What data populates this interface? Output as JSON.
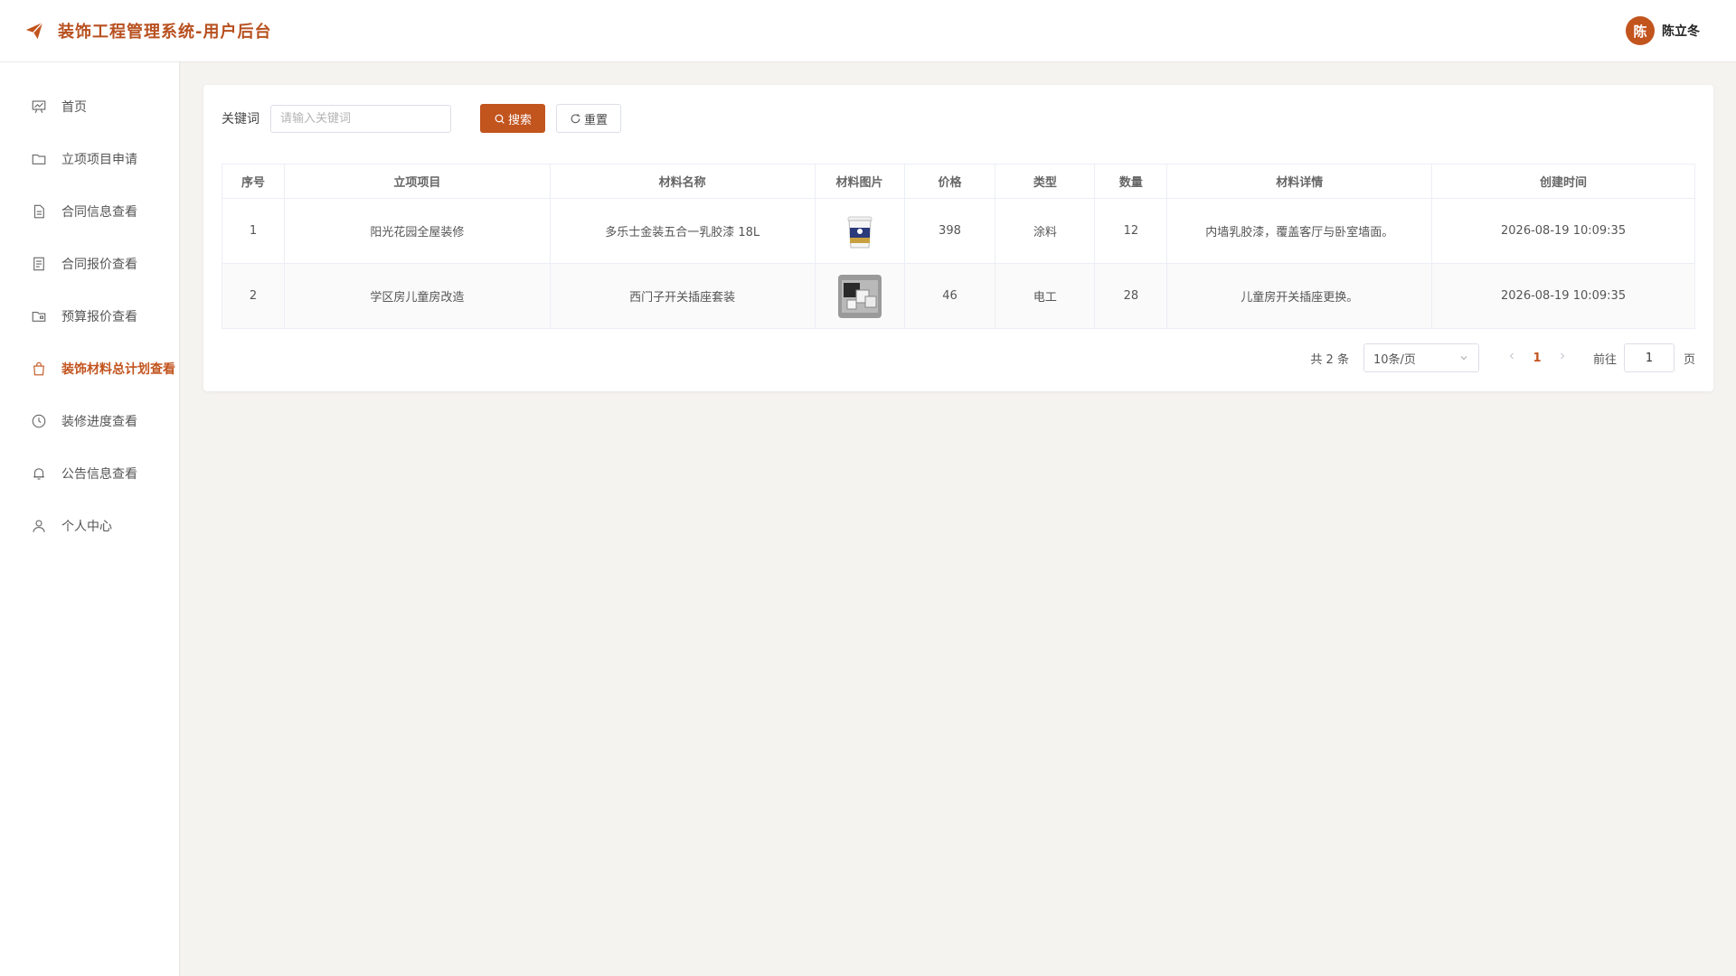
{
  "header": {
    "title": "装饰工程管理系统-用户后台",
    "logo_icon": "paper-plane-icon",
    "user": {
      "avatar_text": "陈",
      "name": "陈立冬"
    }
  },
  "sidebar": {
    "items": [
      {
        "label": "首页",
        "icon": "presentation-chart-icon",
        "active": false
      },
      {
        "label": "立项项目申请",
        "icon": "folder-icon",
        "active": false
      },
      {
        "label": "合同信息查看",
        "icon": "document-icon",
        "active": false
      },
      {
        "label": "合同报价查看",
        "icon": "document-list-icon",
        "active": false
      },
      {
        "label": "预算报价查看",
        "icon": "folder-open-icon",
        "active": false
      },
      {
        "label": "装饰材料总计划查看",
        "icon": "shopping-bag-icon",
        "active": true
      },
      {
        "label": "装修进度查看",
        "icon": "clock-icon",
        "active": false
      },
      {
        "label": "公告信息查看",
        "icon": "bell-icon",
        "active": false
      },
      {
        "label": "个人中心",
        "icon": "user-icon",
        "active": false
      }
    ]
  },
  "search": {
    "label": "关键词",
    "placeholder": "请输入关键词",
    "value": "",
    "search_button": "搜索",
    "reset_button": "重置"
  },
  "table": {
    "columns": [
      "序号",
      "立项项目",
      "材料名称",
      "材料图片",
      "价格",
      "类型",
      "数量",
      "材料详情",
      "创建时间"
    ],
    "rows": [
      {
        "index": "1",
        "project": "阳光花园全屋装修",
        "material": "多乐士金装五合一乳胶漆 18L",
        "image": "paint-bucket-image",
        "price": "398",
        "type": "涂料",
        "quantity": "12",
        "detail": "内墙乳胶漆，覆盖客厅与卧室墙面。",
        "created": "2026-08-19 10:09:35"
      },
      {
        "index": "2",
        "project": "学区房儿童房改造",
        "material": "西门子开关插座套装",
        "image": "switch-socket-image",
        "price": "46",
        "type": "电工",
        "quantity": "28",
        "detail": "儿童房开关插座更换。",
        "created": "2026-08-19 10:09:35"
      }
    ]
  },
  "pagination": {
    "total_text": "共 2 条",
    "page_size": "10条/页",
    "current_page": "1",
    "goto_label": "前往",
    "goto_value": "1",
    "page_unit": "页"
  },
  "colors": {
    "accent": "#c2541e",
    "brand_text": "#b8501f",
    "background": "#f5f3ef"
  }
}
